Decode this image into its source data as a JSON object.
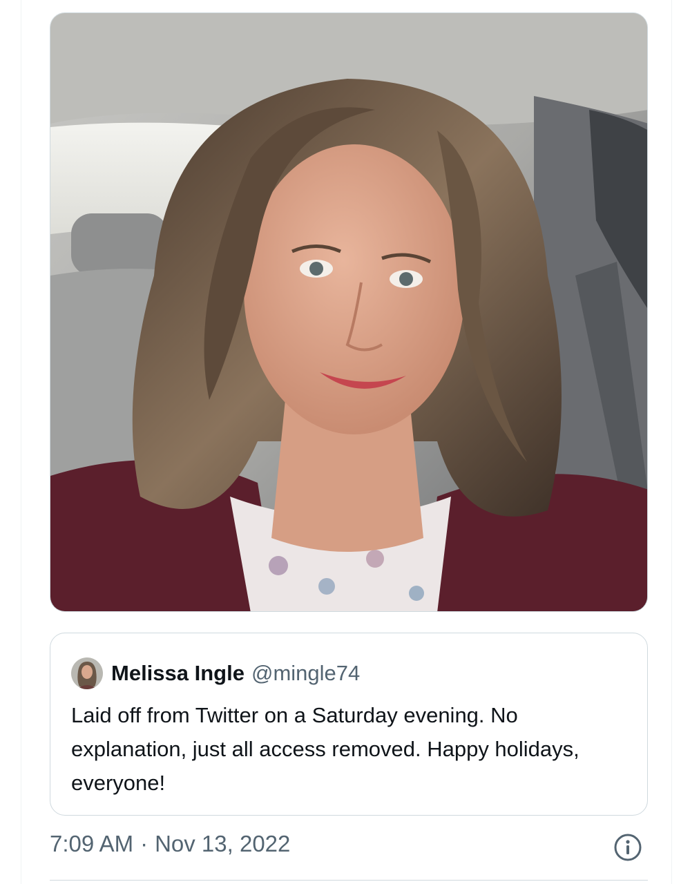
{
  "quoted_tweet": {
    "author_name": "Melissa Ingle",
    "author_handle": "@mingle74",
    "text": "Laid off from Twitter on a Saturday evening. No explanation, just all access removed. Happy holidays, everyone!"
  },
  "tweet_meta": {
    "time": "7:09 AM",
    "separator": "·",
    "date": "Nov 13, 2022"
  },
  "icons": {
    "info": "info-circle-icon"
  },
  "colors": {
    "text_primary": "#0f1419",
    "text_secondary": "#536471",
    "border": "#cfd9de"
  }
}
